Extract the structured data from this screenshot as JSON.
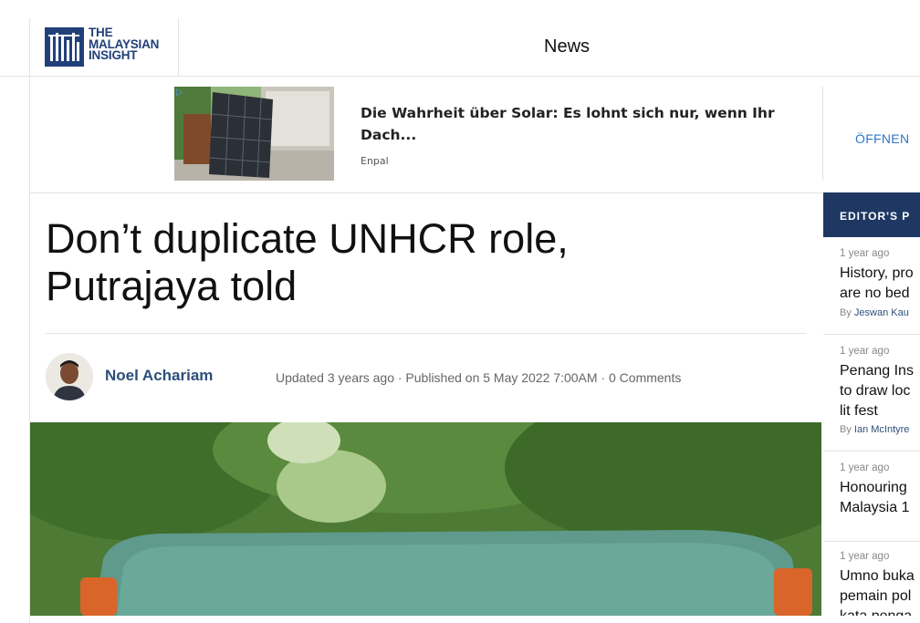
{
  "header": {
    "logo_lines": [
      "THE",
      "MALAYSIAN",
      "INSIGHT"
    ],
    "section": "News"
  },
  "ad": {
    "title": "Die Wahrheit über Solar: Es lohnt sich nur, wenn Ihr Dach...",
    "source": "Enpal",
    "open_label": "ÖFFNEN",
    "icon": "adchoices-icon"
  },
  "article": {
    "headline_line1": "Don’t duplicate UNHCR role,",
    "headline_line2": "Putrajaya told",
    "author": "Noel Achariam",
    "meta": "Updated 3 years ago · Published on 5 May 2022 7:00AM · 0 Comments"
  },
  "sidebar": {
    "heading": "EDITOR'S P",
    "items": [
      {
        "time": "1 year ago",
        "title": "History, pro\nare no bed",
        "by_prefix": "By ",
        "by": "Jeswan Kau"
      },
      {
        "time": "1 year ago",
        "title": "Penang Ins\nto draw loc\nlit fest",
        "by_prefix": "By ",
        "by": "Ian McIntyre"
      },
      {
        "time": "1 year ago",
        "title": "Honouring\nMalaysia 1",
        "by_prefix": "",
        "by": ""
      },
      {
        "time": "1 year ago",
        "title": "Umno buka\npemain pol\nkata penga",
        "by_prefix": "",
        "by": ""
      }
    ]
  },
  "colors": {
    "brand_navy": "#21407a",
    "sidebar_header": "#1f3863",
    "link_blue": "#2f77c6",
    "author_blue": "#2c4f7c"
  }
}
